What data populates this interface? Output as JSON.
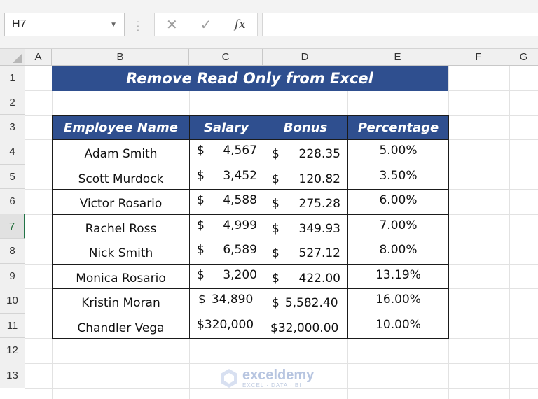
{
  "formula_bar": {
    "name_box": "H7",
    "fx_label": "fx",
    "formula_value": ""
  },
  "columns": [
    "A",
    "B",
    "C",
    "D",
    "E",
    "F",
    "G"
  ],
  "rows": [
    "1",
    "2",
    "3",
    "4",
    "5",
    "6",
    "7",
    "8",
    "9",
    "10",
    "11",
    "12",
    "13"
  ],
  "active_row": "7",
  "sheet": {
    "title": "Remove Read Only from Excel",
    "headers": [
      "Employee Name",
      "Salary",
      "Bonus",
      "Percentage"
    ],
    "records": [
      {
        "name": "Adam Smith",
        "salary_sym": "$",
        "salary": "4,567",
        "bonus_sym": "$",
        "bonus": "228.35",
        "pct": "5.00%"
      },
      {
        "name": "Scott Murdock",
        "salary_sym": "$",
        "salary": "3,452",
        "bonus_sym": "$",
        "bonus": "120.82",
        "pct": "3.50%"
      },
      {
        "name": "Victor Rosario",
        "salary_sym": "$",
        "salary": "4,588",
        "bonus_sym": "$",
        "bonus": "275.28",
        "pct": "6.00%"
      },
      {
        "name": "Rachel Ross",
        "salary_sym": "$",
        "salary": "4,999",
        "bonus_sym": "$",
        "bonus": "349.93",
        "pct": "7.00%"
      },
      {
        "name": "Nick Smith",
        "salary_sym": "$",
        "salary": "6,589",
        "bonus_sym": "$",
        "bonus": "527.12",
        "pct": "8.00%"
      },
      {
        "name": "Monica Rosario",
        "salary_sym": "$",
        "salary": "3,200",
        "bonus_sym": "$",
        "bonus": "422.00",
        "pct": "13.19%"
      },
      {
        "name": "Kristin Moran",
        "salary_sym": "$",
        "salary": "34,890",
        "bonus_sym": "$",
        "bonus": "5,582.40",
        "pct": "16.00%"
      },
      {
        "name": "Chandler Vega",
        "salary_sym": "$",
        "salary": "320,000",
        "bonus_sym": "$",
        "bonus": "32,000.00",
        "pct": "10.00%"
      }
    ]
  },
  "watermark": {
    "name": "exceldemy",
    "tagline": "EXCEL · DATA · BI"
  }
}
